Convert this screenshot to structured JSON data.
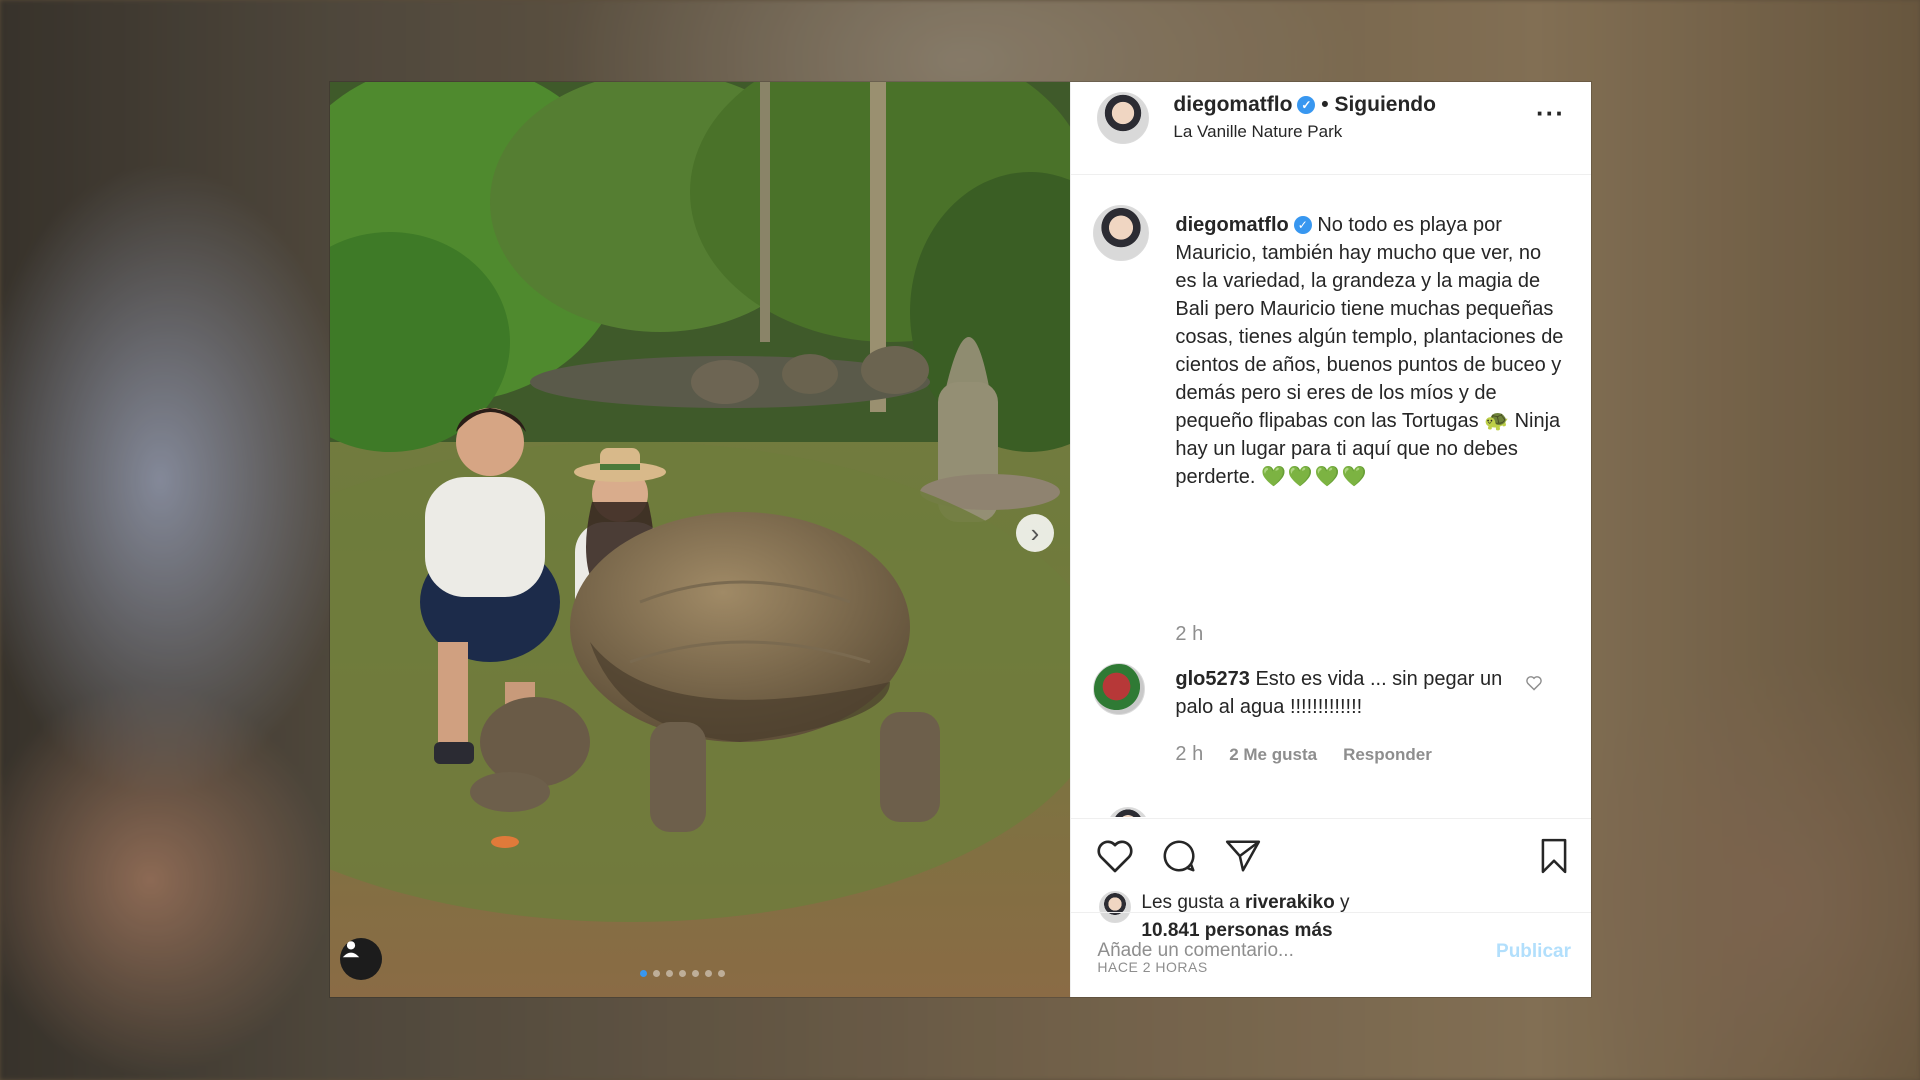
{
  "colors": {
    "accent": "#3897f0",
    "text": "#262626",
    "muted": "#8e8e8e",
    "publish_disabled": "#b2dffc",
    "hearts": "#22c40c"
  },
  "post": {
    "header": {
      "username": "diegomatflo",
      "separator": "•",
      "follow_status": "Siguiendo",
      "location": "La Vanille Nature Park",
      "more_icon": "more-horizontal-icon"
    },
    "media": {
      "carousel_dots": 7,
      "active_dot": 0,
      "next_icon": "chevron-right-icon",
      "tag_icon": "user-tag-icon"
    },
    "caption": {
      "username": "diegomatflo",
      "text": "No todo es playa por Mauricio, también hay mucho que ver, no es la variedad, la grandeza y la magia de Bali pero Mauricio tiene muchas pequeñas cosas, tienes algún templo, plantaciones de cientos de años, buenos puntos de buceo y demás pero si eres de los míos y de pequeño flipabas con las Tortugas 🐢 Ninja hay un lugar para ti aquí que no debes perderte.",
      "emoji_tail": "💚💚💚💚",
      "time": "2 h"
    },
    "comments": [
      {
        "username": "glo5273",
        "text": "Esto es vida ... sin pegar un palo al agua !!!!!!!!!!!!!",
        "time": "2 h",
        "likes": "2 Me gusta",
        "reply": "Responder"
      }
    ],
    "actions": {
      "like_icon": "heart-icon",
      "comment_icon": "comment-icon",
      "share_icon": "share-icon",
      "save_icon": "bookmark-icon"
    },
    "likes": {
      "prefix": "Les gusta a",
      "user": "riverakiko",
      "joiner": "y",
      "others": "10.841 personas más"
    },
    "time_ago": "HACE 2 HORAS",
    "add_comment": {
      "placeholder": "Añade un comentario...",
      "publish_label": "Publicar"
    }
  }
}
